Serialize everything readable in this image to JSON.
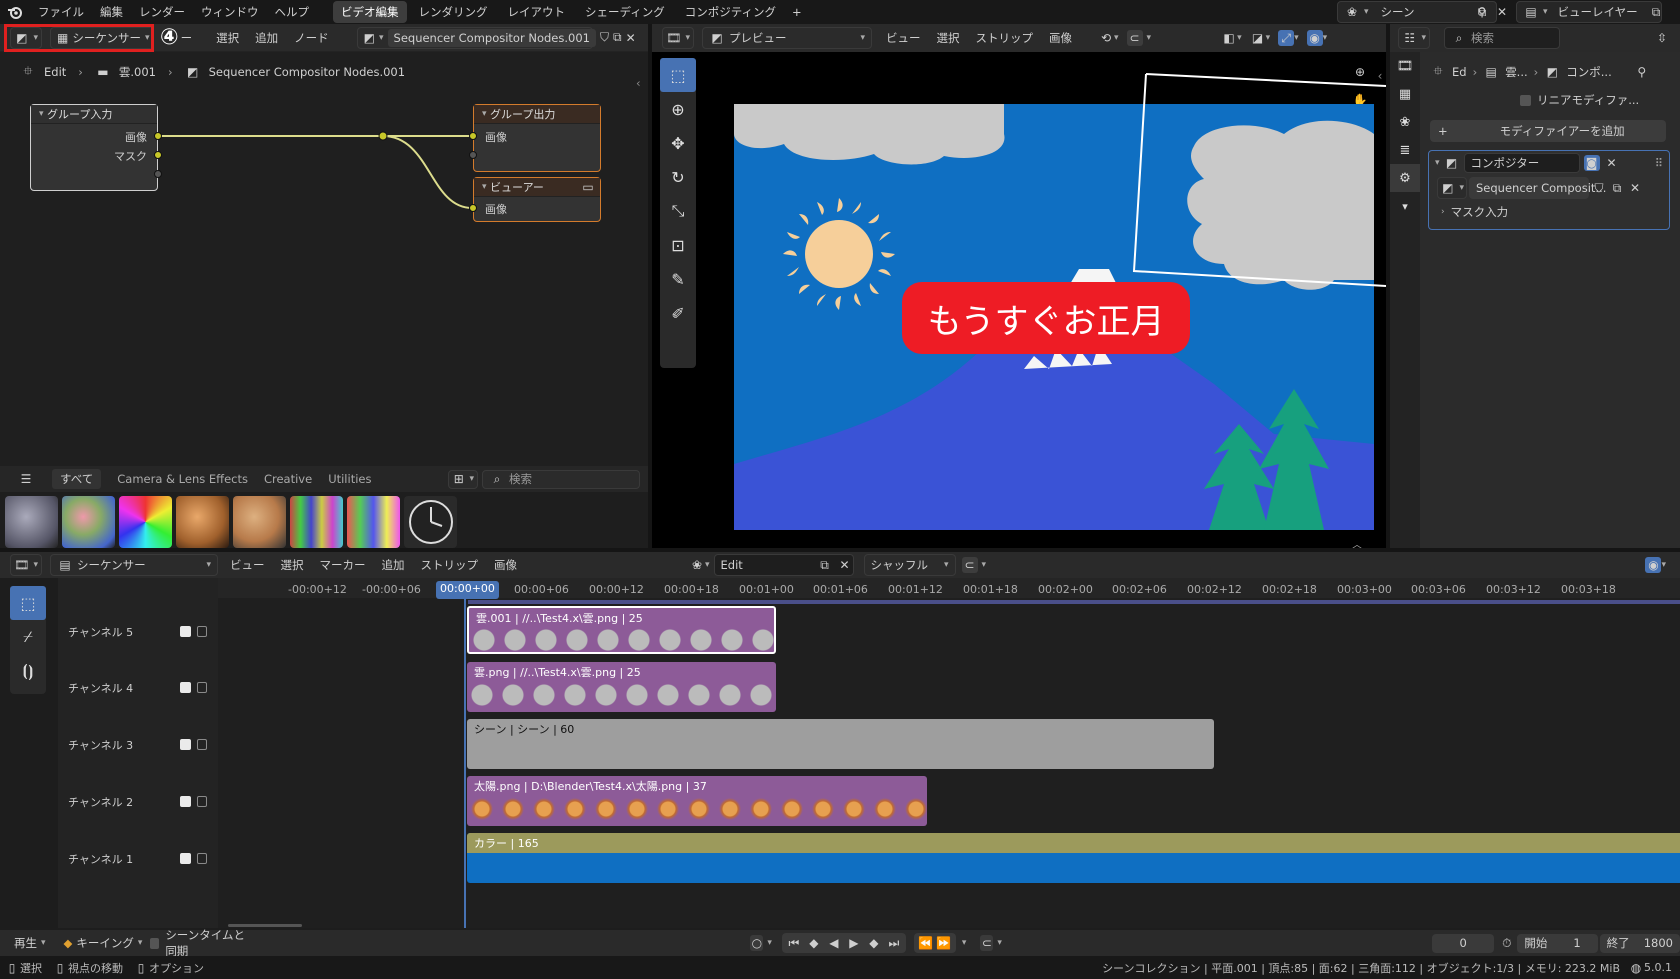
{
  "topbar": {
    "menus": [
      "ファイル",
      "編集",
      "レンダー",
      "ウィンドウ",
      "ヘルプ"
    ],
    "workspaces": [
      "ビデオ編集",
      "レンダリング",
      "レイアウト",
      "シェーディング",
      "コンポジティング"
    ],
    "active_workspace": "ビデオ編集",
    "scene": "シーン",
    "view_layer": "ビューレイヤー"
  },
  "node_editor": {
    "editor_type": "シーケンサー",
    "annotation": "④",
    "menus": [
      "ー",
      "選択",
      "追加",
      "ノード"
    ],
    "node_group": "Sequencer Compositor Nodes.001",
    "breadcrumb": [
      "Edit",
      "雲.001",
      "Sequencer Compositor Nodes.001"
    ],
    "nodes": {
      "group_input": {
        "title": "グループ入力",
        "outputs": [
          "画像",
          "マスク"
        ]
      },
      "group_output": {
        "title": "グループ出力",
        "inputs": [
          "画像"
        ]
      },
      "viewer": {
        "title": "ビューアー",
        "inputs": [
          "画像"
        ]
      }
    },
    "asset_tabs": [
      "すべて",
      "Camera & Lens Effects",
      "Creative",
      "Utilities"
    ],
    "search_placeholder": "検索"
  },
  "preview": {
    "mode": "プレビュー",
    "menus": [
      "ビュー",
      "選択",
      "ストリップ",
      "画像"
    ],
    "caption": "もうすぐお正月"
  },
  "properties": {
    "search_placeholder": "検索",
    "breadcrumb": [
      "Ed",
      "雲...",
      "コンポ..."
    ],
    "linear_modifier": "リニアモディファ...",
    "add_modifier": "モディファイアーを追加",
    "compositor_label": "コンポジター",
    "node_group": "Sequencer Composit...",
    "mask_input": "マスク入力"
  },
  "sequencer": {
    "editor_type": "シーケンサー",
    "menus": [
      "ビュー",
      "選択",
      "マーカー",
      "追加",
      "ストリップ",
      "画像"
    ],
    "edit_name": "Edit",
    "overlap_mode": "シャッフル",
    "current_time": "00:00+00",
    "ticks": [
      "-00:00+12",
      "-00:00+06",
      "00:00+00",
      "00:00+06",
      "00:00+12",
      "00:00+18",
      "00:01+00",
      "00:01+06",
      "00:01+12",
      "00:01+18",
      "00:02+00",
      "00:02+06",
      "00:02+12",
      "00:02+18",
      "00:03+00",
      "00:03+06",
      "00:03+12",
      "00:03+18"
    ],
    "channels": [
      "チャンネル 5",
      "チャンネル 4",
      "チャンネル 3",
      "チャンネル 2",
      "チャンネル 1"
    ],
    "strips": [
      {
        "label": "雲.001 | //..\\Test4.x\\雲.png | 25",
        "channel": 5
      },
      {
        "label": "雲.png | //..\\Test4.x\\雲.png | 25",
        "channel": 4
      },
      {
        "label": "シーン | シーン | 60",
        "channel": 3
      },
      {
        "label": "太陽.png | D:\\Blender\\Test4.x\\太陽.png | 37",
        "channel": 2
      },
      {
        "label": "カラー | 165",
        "channel": 1
      }
    ]
  },
  "playback": {
    "play": "再生",
    "keying": "キーイング",
    "sync": "シーンタイムと同期",
    "frame": "0",
    "start_label": "開始",
    "start": "1",
    "end_label": "終了",
    "end": "1800"
  },
  "statusbar": {
    "select": "選択",
    "move_view": "視点の移動",
    "options": "オプション",
    "stats": "シーンコレクション | 平面.001 | 頂点:85 | 面:62 | 三角面:112 | オブジェクト:1/3 | メモリ: 223.2 MiB",
    "version": "5.0.1"
  },
  "colors": {
    "accent": "#4772b3",
    "annotation_box": "#e0201f",
    "strip_image": "#8d5b98",
    "strip_scene": "#9e9e9e",
    "strip_color": "#9c9a5c",
    "sky": "#0f6fc2",
    "mountain": "#3a53d6",
    "tree": "#17a07e",
    "sun": "#f6cf9a",
    "caption_bg": "#ee1c25"
  }
}
